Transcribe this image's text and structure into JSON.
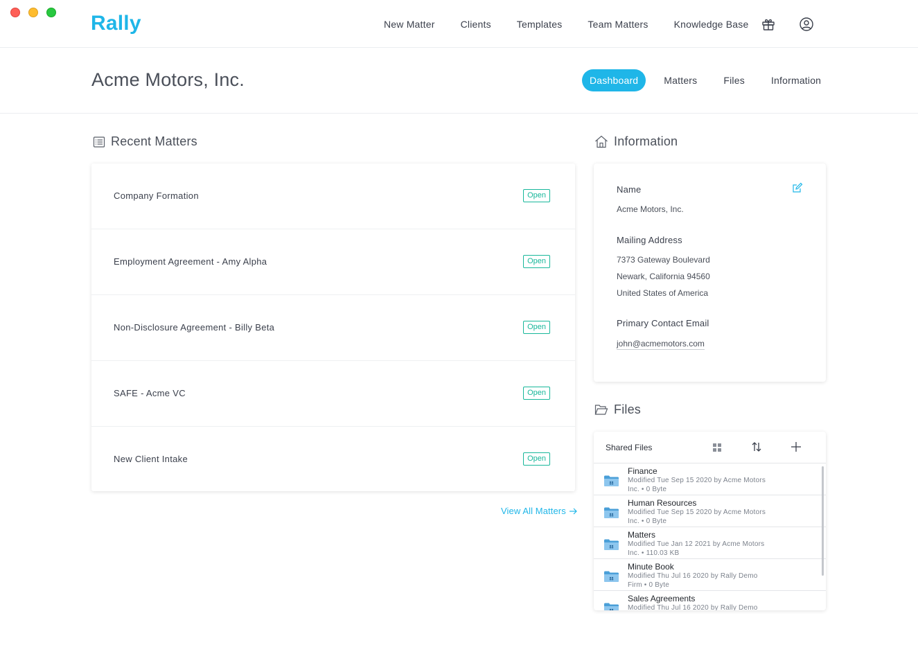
{
  "app": {
    "logo": "Rally"
  },
  "nav": {
    "items": [
      "New Matter",
      "Clients",
      "Templates",
      "Team Matters",
      "Knowledge Base"
    ],
    "icons": [
      "gift-icon",
      "user-icon"
    ]
  },
  "client": {
    "name": "Acme Motors, Inc.",
    "tabs": [
      {
        "label": "Dashboard",
        "active": true
      },
      {
        "label": "Matters",
        "active": false
      },
      {
        "label": "Files",
        "active": false
      },
      {
        "label": "Information",
        "active": false
      }
    ]
  },
  "recent_matters": {
    "title": "Recent Matters",
    "items": [
      {
        "title": "Company Formation",
        "status": "Open"
      },
      {
        "title": "Employment Agreement - Amy Alpha",
        "status": "Open"
      },
      {
        "title": "Non-Disclosure Agreement - Billy Beta",
        "status": "Open"
      },
      {
        "title": "SAFE - Acme VC",
        "status": "Open"
      },
      {
        "title": "New Client Intake",
        "status": "Open"
      }
    ],
    "view_all": "View All Matters"
  },
  "information": {
    "title": "Information",
    "name_label": "Name",
    "name_value": "Acme Motors, Inc.",
    "address_label": "Mailing Address",
    "address_lines": [
      "7373 Gateway Boulevard",
      "Newark, California 94560",
      "United States of America"
    ],
    "email_label": "Primary Contact Email",
    "email_value": "john@acmemotors.com"
  },
  "files": {
    "title": "Files",
    "header_label": "Shared Files",
    "items": [
      {
        "name": "Finance",
        "meta_line1": "Modified Tue Sep 15 2020 by Acme Motors",
        "meta_line2": "Inc. • 0 Byte"
      },
      {
        "name": "Human Resources",
        "meta_line1": "Modified Tue Sep 15 2020 by Acme Motors",
        "meta_line2": "Inc. • 0 Byte"
      },
      {
        "name": "Matters",
        "meta_line1": "Modified Tue Jan 12 2021 by Acme Motors",
        "meta_line2": "Inc. • 110.03 KB"
      },
      {
        "name": "Minute Book",
        "meta_line1": "Modified Thu Jul 16 2020 by Rally Demo",
        "meta_line2": "Firm • 0 Byte"
      },
      {
        "name": "Sales Agreements",
        "meta_line1": "Modified Thu Jul 16 2020 by Rally Demo",
        "meta_line2": ""
      }
    ]
  },
  "colors": {
    "accent": "#1fb6e8",
    "status_open": "#17b79a"
  }
}
